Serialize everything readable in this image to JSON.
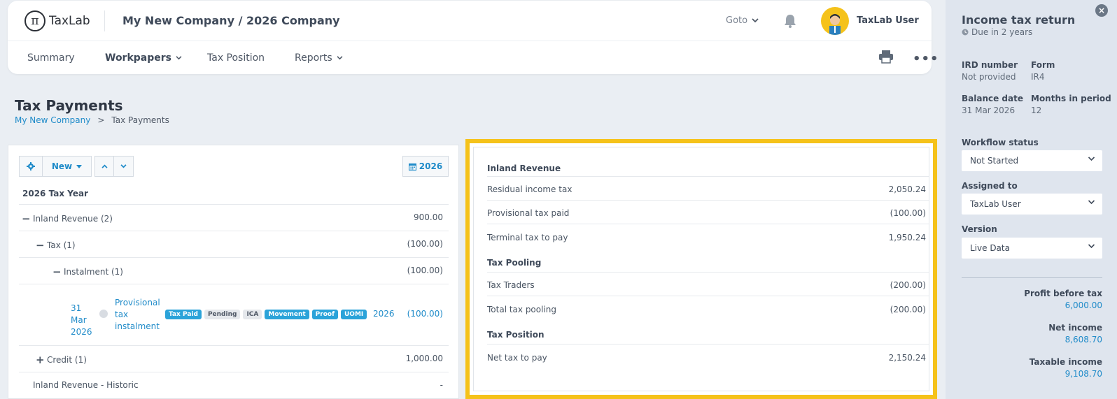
{
  "header": {
    "logo_text": "TaxLab",
    "company": "My New Company / 2026 Company",
    "goto_label": "Goto",
    "user_name": "TaxLab User"
  },
  "nav": {
    "items": [
      {
        "label": "Summary"
      },
      {
        "label": "Workpapers"
      },
      {
        "label": "Tax Position"
      },
      {
        "label": "Reports"
      }
    ]
  },
  "page": {
    "title": "Tax Payments",
    "breadcrumb": [
      "My New Company",
      ">",
      "Tax Payments"
    ]
  },
  "toolbar": {
    "new_label": "New",
    "year_label": "2026"
  },
  "tree": {
    "heading": "2026 Tax Year",
    "rows": [
      {
        "label": "Inland Revenue (2)",
        "value": "900.00"
      },
      {
        "label": "Tax (1)",
        "value": "(100.00)"
      },
      {
        "label": "Instalment (1)",
        "value": "(100.00)"
      },
      {
        "date_line1": "31",
        "date_line2": "Mar",
        "date_line3": "2026",
        "desc_line1": "Provisional",
        "desc_line2": "tax",
        "desc_line3": "instalment",
        "badges": [
          "Tax Paid",
          "Pending",
          "ICA",
          "Movement",
          "Proof",
          "UOMI"
        ],
        "year": "2026",
        "value": "(100.00)"
      },
      {
        "label": "Credit (1)",
        "value": "1,000.00"
      },
      {
        "label": "Inland Revenue - Historic",
        "value": "-"
      }
    ]
  },
  "summary": {
    "section1": "Inland Revenue",
    "residual_label": "Residual income tax",
    "residual_value": "2,050.24",
    "provisional_label": "Provisional tax paid",
    "provisional_value": "(100.00)",
    "terminal_label": "Terminal tax to pay",
    "terminal_value": "1,950.24",
    "section2": "Tax Pooling",
    "traders_label": "Tax Traders",
    "traders_value": "(200.00)",
    "pooling_label": "Total tax pooling",
    "pooling_value": "(200.00)",
    "section3": "Tax Position",
    "net_label": "Net tax to pay",
    "net_value": "2,150.24"
  },
  "sidebar": {
    "title": "Income tax return",
    "due": "Due in 2 years",
    "ird_label": "IRD number",
    "ird_value": "Not provided",
    "form_label": "Form",
    "form_value": "IR4",
    "balance_label": "Balance date",
    "balance_value": "31 Mar 2026",
    "months_label": "Months in period",
    "months_value": "12",
    "workflow_label": "Workflow status",
    "workflow_value": "Not Started",
    "assigned_label": "Assigned to",
    "assigned_value": "TaxLab User",
    "version_label": "Version",
    "version_value": "Live Data",
    "profit_label": "Profit before tax",
    "profit_value": "6,000.00",
    "net_income_label": "Net income",
    "net_income_value": "8,608.70",
    "taxable_label": "Taxable income",
    "taxable_value": "9,108.70"
  },
  "colors": {
    "highlight": "#f5c21a",
    "link": "#1f8bc9",
    "badge_blue": "#2ba3d9"
  }
}
